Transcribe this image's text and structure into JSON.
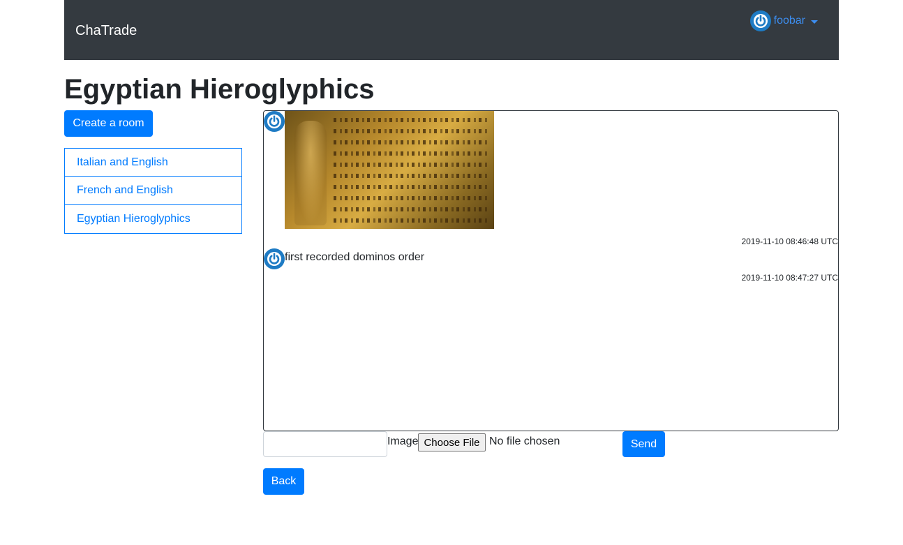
{
  "navbar": {
    "brand": "ChaTrade",
    "username": "foobar",
    "avatar_icon": "power-icon",
    "caret_icon": "caret-down-icon"
  },
  "page": {
    "title": "Egyptian Hieroglyphics"
  },
  "sidebar": {
    "create_label": "Create a room",
    "rooms": [
      {
        "label": "Italian and English"
      },
      {
        "label": "French and English"
      },
      {
        "label": "Egyptian Hieroglyphics"
      }
    ]
  },
  "chat": {
    "messages": [
      {
        "type": "image",
        "avatar_icon": "power-icon",
        "timestamp": "2019-11-10 08:46:48 UTC"
      },
      {
        "type": "text",
        "avatar_icon": "power-icon",
        "text": "first recorded dominos order",
        "timestamp": "2019-11-10 08:47:27 UTC"
      }
    ]
  },
  "form": {
    "text_value": "",
    "image_label": "Image",
    "choose_file_label": "Choose File",
    "file_status": "No file chosen",
    "send_label": "Send"
  },
  "back_label": "Back",
  "colors": {
    "navbar_bg": "#343a40",
    "primary": "#007bff",
    "avatar": "#1e7bc4"
  }
}
